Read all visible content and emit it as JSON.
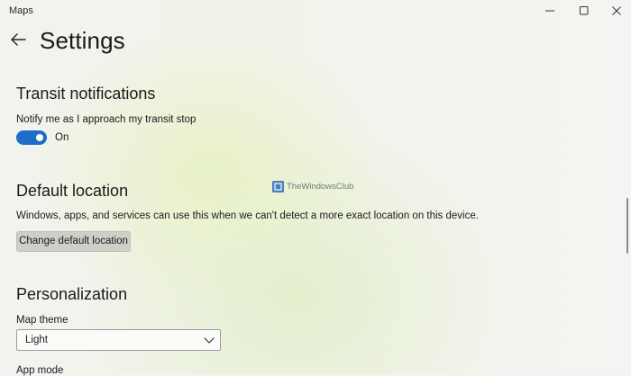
{
  "window": {
    "app_title": "Maps"
  },
  "header": {
    "title": "Settings"
  },
  "transit": {
    "title": "Transit notifications",
    "description": "Notify me as I approach my transit stop",
    "toggle_on": true,
    "toggle_state_text": "On"
  },
  "default_location": {
    "title": "Default location",
    "description": "Windows, apps, and services can use this when we can't detect a more exact location on this device.",
    "button_label": "Change default location"
  },
  "personalization": {
    "title": "Personalization",
    "map_theme_label": "Map theme",
    "map_theme_value": "Light",
    "app_mode_label": "App mode"
  },
  "watermark": {
    "text": "TheWindowsClub"
  },
  "colors": {
    "accent": "#1d6ec9"
  }
}
